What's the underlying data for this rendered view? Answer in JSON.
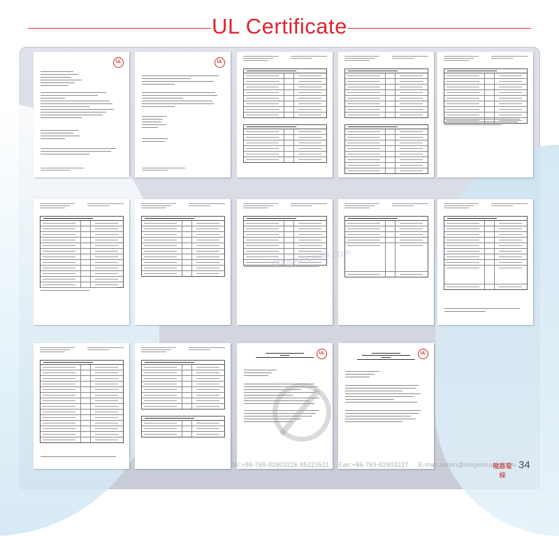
{
  "header": {
    "title": "UL Certificate"
  },
  "watermark": "xlongxincable.com",
  "footer": {
    "tel": "Tel:+86-769-82803226 85223511",
    "fax": "Fax:+86-769-82803227",
    "email": "E-mail:admin@longxincable.com",
    "brand": "龍鑫電線",
    "page": "34"
  },
  "colors": {
    "title": "#e0232e",
    "panel": "#d6d9e1",
    "logo": "#c62828"
  }
}
